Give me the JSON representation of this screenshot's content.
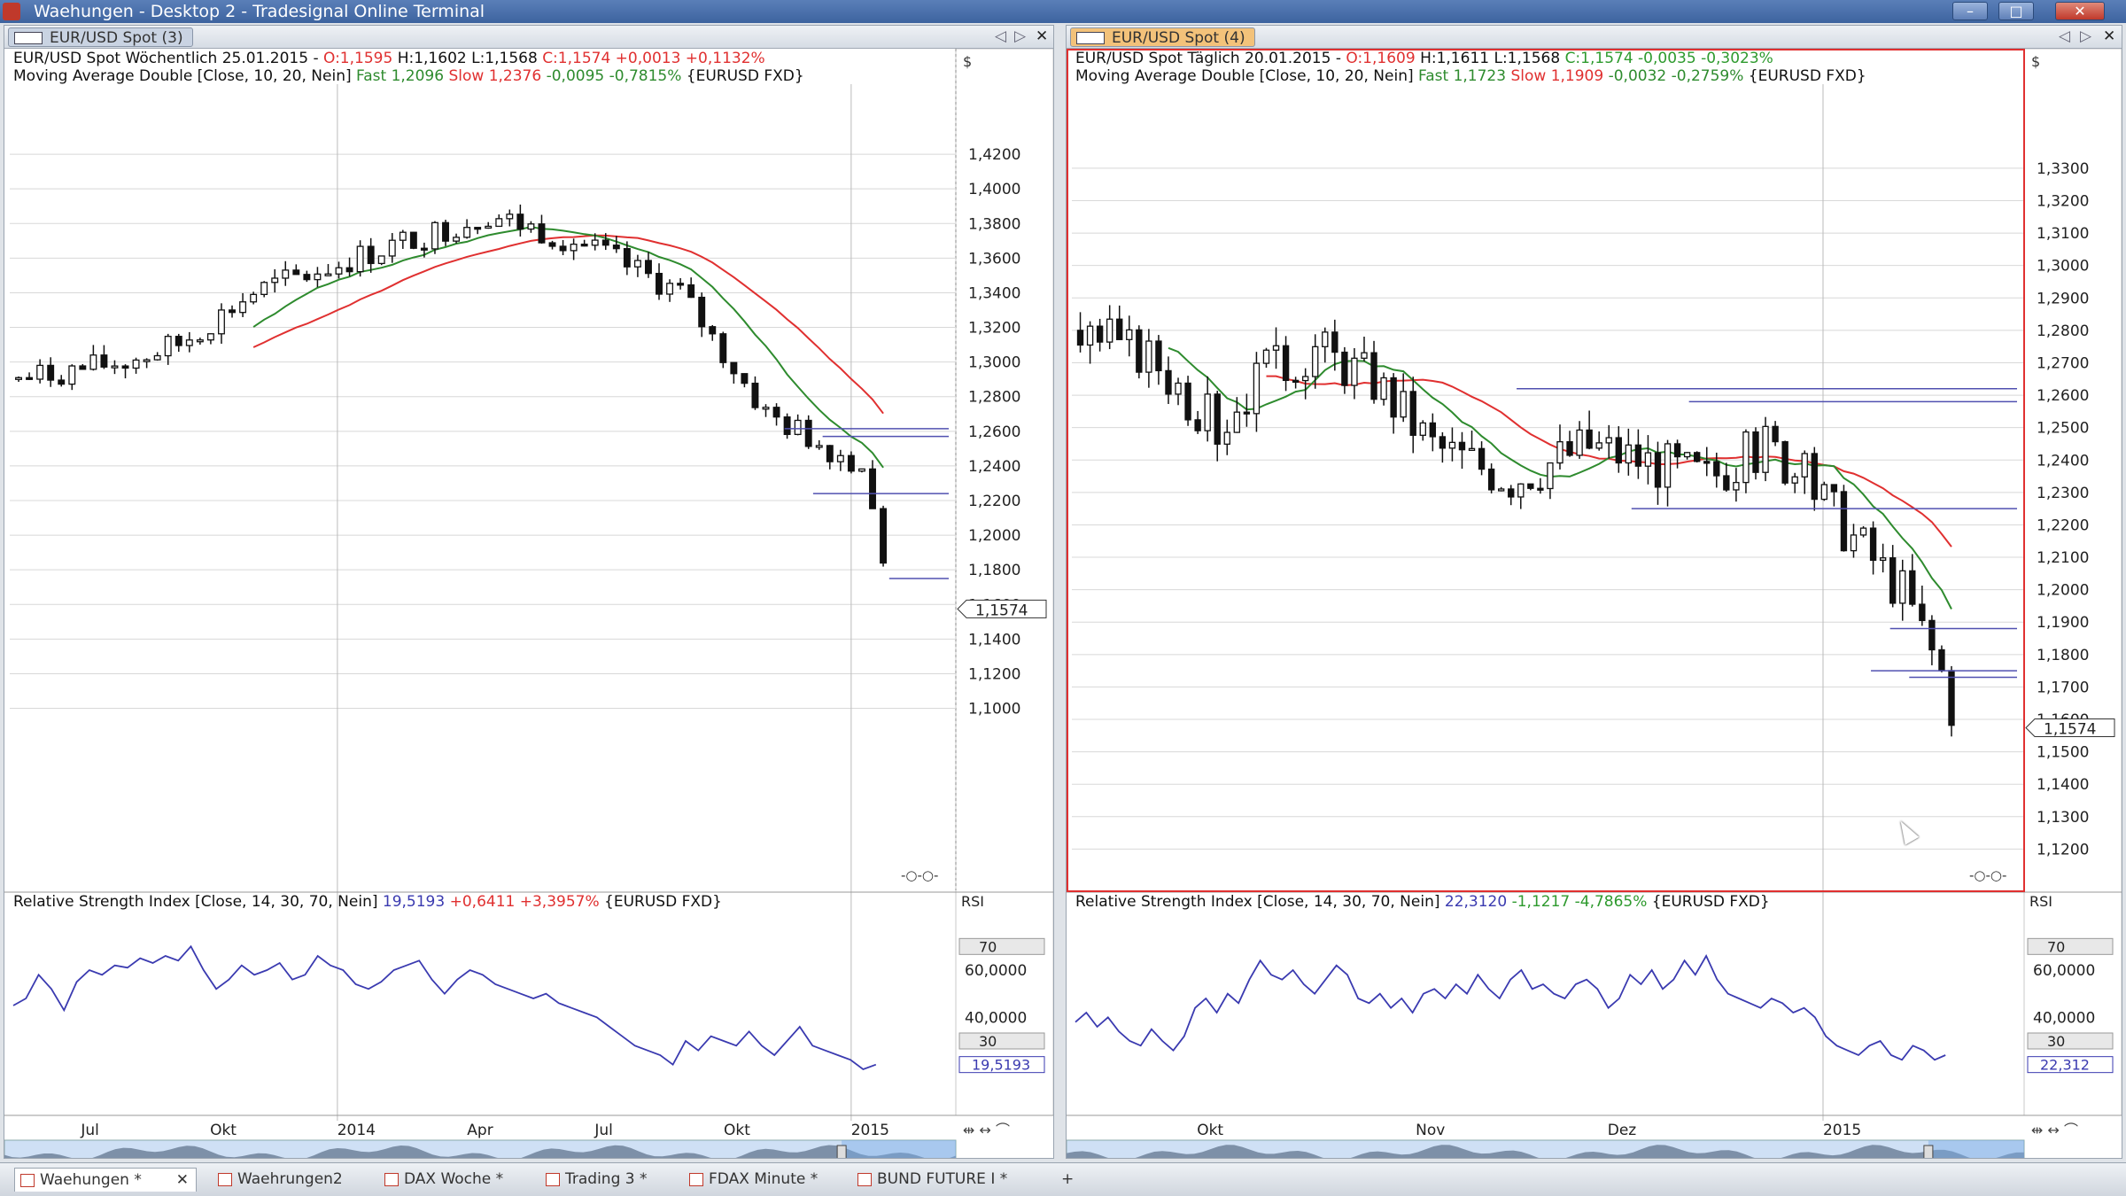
{
  "window": {
    "title": "Waehungen - Desktop 2 - Tradesignal Online Terminal",
    "min_label": "–",
    "max_label": "□",
    "close_label": "✕"
  },
  "colors": {
    "candle": "#111111",
    "fast_ma": "#2e8b2e",
    "slow_ma": "#e03030",
    "rsi": "#3a3ab0",
    "hline": "#5050b0",
    "grid": "#d8d8d8",
    "ohlc_red": "#e03030",
    "ohlc_green": "#2e9a2e"
  },
  "icons": [
    "app-icon",
    "panel-layout-icon",
    "chart-tab-icon",
    "close-icon",
    "pin-icon",
    "nav-left-icon",
    "nav-right-icon",
    "doc-icon",
    "add-tab-icon"
  ],
  "panels": [
    {
      "tab": "EUR/USD Spot (3)",
      "seed": 7,
      "n": 82,
      "ma_start": 22,
      "price": {
        "min": 1.0,
        "max": 1.44,
        "start": 1.29,
        "anchors": [
          [
            0,
            1.29
          ],
          [
            10,
            1.3
          ],
          [
            15,
            1.31
          ],
          [
            22,
            1.34
          ],
          [
            34,
            1.365
          ],
          [
            44,
            1.385
          ],
          [
            52,
            1.37
          ],
          [
            62,
            1.34
          ],
          [
            70,
            1.27
          ],
          [
            76,
            1.25
          ],
          [
            79,
            1.24
          ],
          [
            82,
            1.155
          ]
        ]
      },
      "info": {
        "label": "EUR/USD Spot Wöchentlich  25.01.2015 - ",
        "o": "O:1,1595",
        "h": " H:1,1602 L:1,1568 ",
        "c": "C:1,1574 +0,0013 +0,1132%"
      },
      "ma_info": {
        "label": "Moving Average Double [Close, 10, 20, Nein] ",
        "fast": "Fast 1,2096",
        "slow": " Slow 1,2376",
        "chg": " -0,0095 -0,7815%",
        "src": " {EURUSD FXD}"
      },
      "rsi_info": {
        "label": "Relative Strength Index [Close, 14, 30, 70, Nein] ",
        "val": "19,5193",
        "chg": " +0,6411 +3,3957%",
        "src": " {EURUSD FXD}"
      },
      "rsi_series": [
        45,
        48,
        58,
        52,
        43,
        55,
        60,
        58,
        62,
        61,
        65,
        63,
        66,
        64,
        70,
        60,
        52,
        56,
        62,
        58,
        60,
        63,
        56,
        58,
        66,
        62,
        60,
        54,
        52,
        55,
        60,
        62,
        64,
        56,
        50,
        56,
        60,
        58,
        54,
        52,
        50,
        48,
        50,
        46,
        44,
        42,
        40,
        36,
        32,
        28,
        26,
        24,
        20,
        30,
        26,
        32,
        30,
        28,
        34,
        28,
        24,
        30,
        36,
        28,
        26,
        24,
        22,
        18,
        20
      ],
      "y_ticks": [
        "1,4200",
        "1,4000",
        "1,3800",
        "1,3600",
        "1,3400",
        "1,3200",
        "1,3000",
        "1,2800",
        "1,2600",
        "1,2400",
        "1,2200",
        "1,2000",
        "1,1800",
        "1,1600",
        "1,1400",
        "1,1200",
        "1,1000"
      ],
      "y_tick_values": [
        1.42,
        1.4,
        1.38,
        1.36,
        1.34,
        1.32,
        1.3,
        1.28,
        1.26,
        1.24,
        1.22,
        1.2,
        1.18,
        1.16,
        1.14,
        1.12,
        1.1
      ],
      "last_price": "1,1574",
      "last_value": 1.1574,
      "currency": "$",
      "hlines": [
        {
          "y": 1.2615,
          "x0": 0.82
        },
        {
          "y": 1.257,
          "x0": 0.86
        },
        {
          "y": 1.224,
          "x0": 0.85
        },
        {
          "y": 1.175,
          "x0": 0.93
        }
      ],
      "rsi_axis": {
        "top": "70",
        "t60": "60,0000",
        "t40": "40,0000",
        "bottom": "30",
        "value": "19,5193",
        "label": "RSI"
      },
      "x_labels": [
        {
          "text": "Jul",
          "f": 0.09
        },
        {
          "text": "Okt",
          "f": 0.23
        },
        {
          "text": "2014",
          "f": 0.37
        },
        {
          "text": "Apr",
          "f": 0.5
        },
        {
          "text": "Jul",
          "f": 0.63
        },
        {
          "text": "Okt",
          "f": 0.77
        },
        {
          "text": "2015",
          "f": 0.91
        }
      ],
      "vlines": [
        0.35,
        0.89
      ],
      "scroll_marker": 0.88,
      "dash_label": "-○‐○-"
    },
    {
      "tab": "EUR/USD Spot (4)",
      "seed": 3,
      "n": 90,
      "ma_start": 0,
      "price": {
        "min": 1.11,
        "max": 1.345,
        "start": 1.28,
        "anchors": [
          [
            0,
            1.28
          ],
          [
            8,
            1.27
          ],
          [
            14,
            1.25
          ],
          [
            18,
            1.265
          ],
          [
            24,
            1.275
          ],
          [
            30,
            1.265
          ],
          [
            36,
            1.245
          ],
          [
            44,
            1.235
          ],
          [
            52,
            1.245
          ],
          [
            58,
            1.24
          ],
          [
            64,
            1.235
          ],
          [
            70,
            1.245
          ],
          [
            74,
            1.235
          ],
          [
            78,
            1.22
          ],
          [
            84,
            1.2
          ],
          [
            88,
            1.175
          ],
          [
            90,
            1.155
          ]
        ]
      },
      "info": {
        "label": "EUR/USD Spot Täglich  20.01.2015 - ",
        "o": "O:1,1609",
        "h": " H:1,1611 L:1,1568 ",
        "c": "C:1,1574 -0,0035 -0,3023%"
      },
      "ma_info": {
        "label": "Moving Average Double [Close, 10, 20, Nein] ",
        "fast": "Fast 1,1723",
        "slow": " Slow 1,1909",
        "chg": " -0,0032 -0,2759%",
        "src": " {EURUSD FXD}"
      },
      "rsi_info": {
        "label": "Relative Strength Index [Close, 14, 30, 70, Nein] ",
        "val": "22,3120",
        "chg": " -1,1217 -4,7865%",
        "src": " {EURUSD FXD}"
      },
      "rsi_series": [
        38,
        42,
        36,
        40,
        34,
        30,
        28,
        35,
        30,
        26,
        32,
        44,
        48,
        42,
        50,
        46,
        56,
        64,
        58,
        56,
        60,
        54,
        50,
        56,
        62,
        58,
        48,
        46,
        50,
        44,
        48,
        42,
        50,
        52,
        48,
        54,
        50,
        58,
        52,
        48,
        56,
        60,
        52,
        54,
        50,
        48,
        54,
        56,
        52,
        44,
        48,
        58,
        54,
        60,
        52,
        56,
        64,
        58,
        66,
        56,
        50,
        48,
        46,
        44,
        48,
        46,
        42,
        44,
        40,
        32,
        28,
        26,
        24,
        28,
        30,
        24,
        22,
        28,
        26,
        22,
        24
      ],
      "y_ticks": [
        "1,3300",
        "1,3200",
        "1,3100",
        "1,3000",
        "1,2900",
        "1,2800",
        "1,2700",
        "1,2600",
        "1,2500",
        "1,2400",
        "1,2300",
        "1,2200",
        "1,2100",
        "1,2000",
        "1,1900",
        "1,1800",
        "1,1700",
        "1,1600",
        "1,1500",
        "1,1400",
        "1,1300",
        "1,1200"
      ],
      "y_tick_values": [
        1.33,
        1.32,
        1.31,
        1.3,
        1.29,
        1.28,
        1.27,
        1.26,
        1.25,
        1.24,
        1.23,
        1.22,
        1.21,
        1.2,
        1.19,
        1.18,
        1.17,
        1.16,
        1.15,
        1.14,
        1.13,
        1.12
      ],
      "last_price": "1,1574",
      "last_value": 1.1574,
      "currency": "$",
      "hlines": [
        {
          "y": 1.262,
          "x0": 0.47
        },
        {
          "y": 1.258,
          "x0": 0.65
        },
        {
          "y": 1.225,
          "x0": 0.59
        },
        {
          "y": 1.188,
          "x0": 0.86
        },
        {
          "y": 1.175,
          "x0": 0.84
        },
        {
          "y": 1.173,
          "x0": 0.88
        }
      ],
      "rsi_axis": {
        "top": "70",
        "t60": "60,0000",
        "t40": "40,0000",
        "bottom": "30",
        "value": "22,312",
        "label": "RSI"
      },
      "x_labels": [
        {
          "text": "Okt",
          "f": 0.15
        },
        {
          "text": "Nov",
          "f": 0.38
        },
        {
          "text": "Dez",
          "f": 0.58
        },
        {
          "text": "2015",
          "f": 0.81
        }
      ],
      "vlines": [
        0.79
      ],
      "scroll_marker": 0.9,
      "dash_label": "-○‐○-"
    }
  ],
  "taskbar": [
    {
      "label": "Waehungen *",
      "active": true
    },
    {
      "label": "Waehrungen2",
      "active": false
    },
    {
      "label": "DAX Woche *",
      "active": false
    },
    {
      "label": "Trading 3 *",
      "active": false
    },
    {
      "label": "FDAX Minute *",
      "active": false
    },
    {
      "label": "BUND FUTURE I *",
      "active": false
    }
  ]
}
